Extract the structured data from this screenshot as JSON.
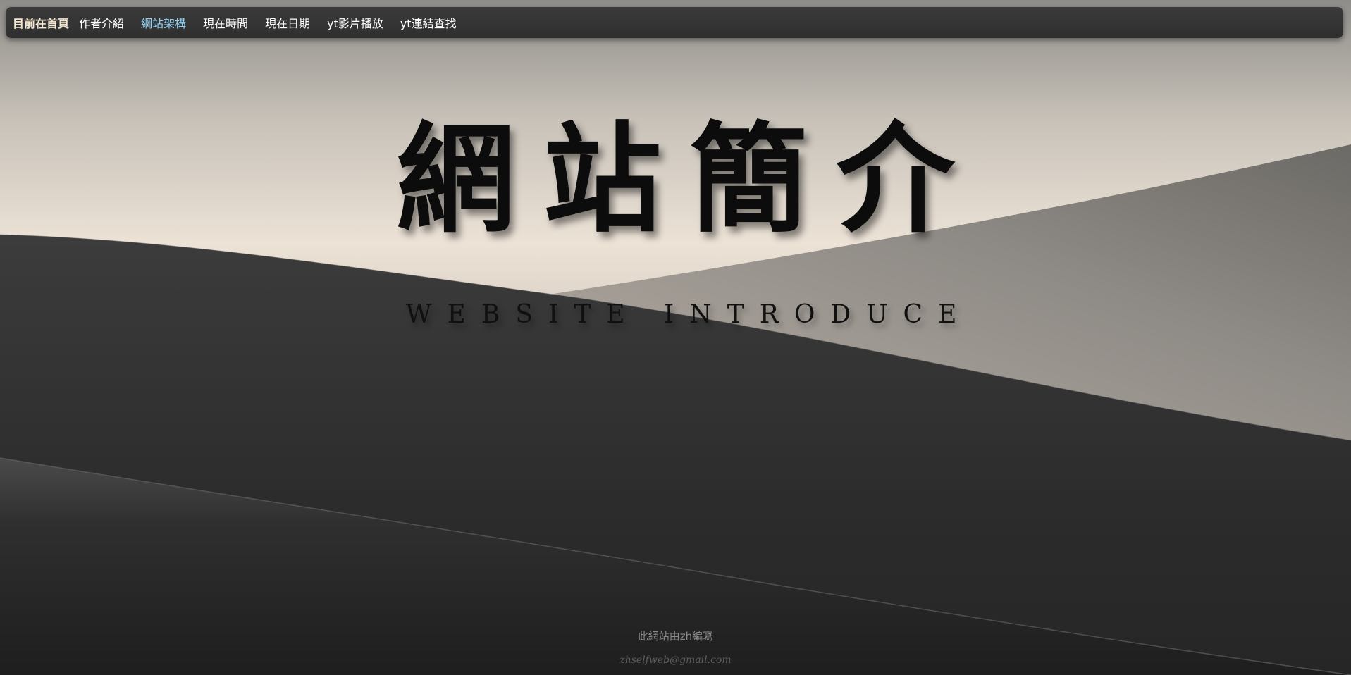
{
  "navbar": {
    "brand": "目前在首頁",
    "items": [
      {
        "label": "作者介紹"
      },
      {
        "label": "網站架構",
        "active": true
      },
      {
        "label": "現在時間"
      },
      {
        "label": "現在日期"
      },
      {
        "label": "yt影片播放"
      },
      {
        "label": "yt連結查找"
      }
    ]
  },
  "hero": {
    "title": "網站簡介",
    "subtitle": "WEBSITE INTRODUCE"
  },
  "footer": {
    "credit": "此網站由zh編寫",
    "email": "zhselfweb@gmail.com"
  },
  "colors": {
    "navbar_bg": "#333333",
    "brand_text": "#f3e6cf",
    "active_link": "#8fd0f2",
    "nav_text": "#ffffff",
    "title_text": "#0c0c0c"
  }
}
